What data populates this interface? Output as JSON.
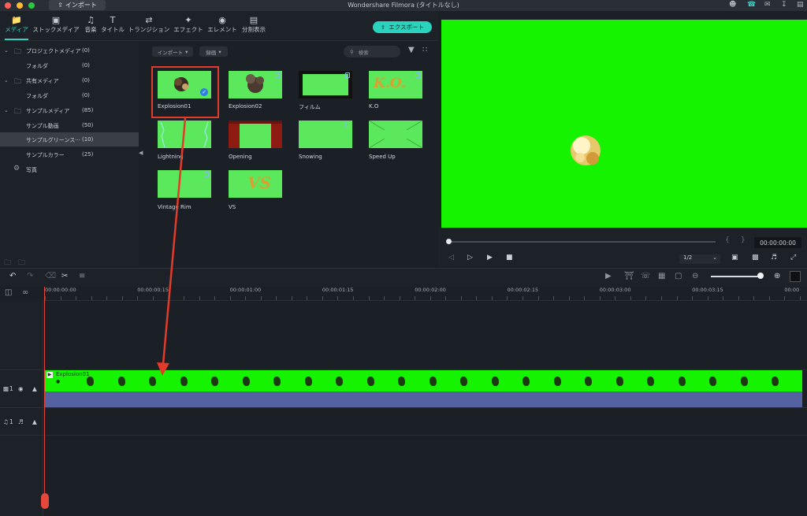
{
  "titlebar": {
    "import_tab": "インポート",
    "window_title": "Wondershare Filmora (タイトルなし)"
  },
  "toolbar": {
    "tabs": [
      {
        "label": "メディア",
        "icon": "folder-icon"
      },
      {
        "label": "ストックメディア",
        "icon": "stock-media-icon"
      },
      {
        "label": "音楽",
        "icon": "music-note-icon"
      },
      {
        "label": "タイトル",
        "icon": "text-t-icon"
      },
      {
        "label": "トランジション",
        "icon": "transition-icon"
      },
      {
        "label": "エフェクト",
        "icon": "effects-icon"
      },
      {
        "label": "エレメント",
        "icon": "elements-icon"
      },
      {
        "label": "分割表示",
        "icon": "split-screen-icon"
      }
    ],
    "export_label": "エクスポート"
  },
  "library": {
    "items": [
      {
        "label": "プロジェクトメディア",
        "count": "(0)"
      },
      {
        "label": "フォルダ",
        "count": "(0)"
      },
      {
        "label": "共有メディア",
        "count": "(0)"
      },
      {
        "label": "フォルダ",
        "count": "(0)"
      },
      {
        "label": "サンプルメディア",
        "count": "(85)"
      },
      {
        "label": "サンプル動画",
        "count": "(50)"
      },
      {
        "label": "サンプルグリーンス···",
        "count": "(10)"
      },
      {
        "label": "サンプルカラー",
        "count": "(25)"
      },
      {
        "label": "写真",
        "count": ""
      }
    ]
  },
  "browser": {
    "import_dropdown": "インポート",
    "record_dropdown": "録画",
    "search_placeholder": "検索",
    "thumbnails": [
      {
        "label": "Explosion01"
      },
      {
        "label": "Explosion02"
      },
      {
        "label": "フィルム"
      },
      {
        "label": "K.O"
      },
      {
        "label": "Lightning"
      },
      {
        "label": "Opening"
      },
      {
        "label": "Snowing"
      },
      {
        "label": "Speed Up"
      },
      {
        "label": "Vintage Rim"
      },
      {
        "label": "VS"
      }
    ],
    "ko_text": "K.O.",
    "vs_text": "VS"
  },
  "preview": {
    "timecode": "00:00:00:00",
    "ratio": "1/2",
    "background": "#15f300"
  },
  "timeline": {
    "ruler": [
      "00:00:00:00",
      "00:00:00:15",
      "00:00:01:00",
      "00:00:01:15",
      "00:00:02:00",
      "00:00:02:15",
      "00:00:03:00",
      "00:00:03:15",
      "00:00"
    ],
    "clip_name": "Explosion01",
    "video_track_label": "1",
    "audio_track_label": "1"
  },
  "colors": {
    "accent": "#2ad3bb",
    "highlight": "#e23b2a",
    "green_screen": "#15f300",
    "audio_bar": "#5562a2"
  }
}
